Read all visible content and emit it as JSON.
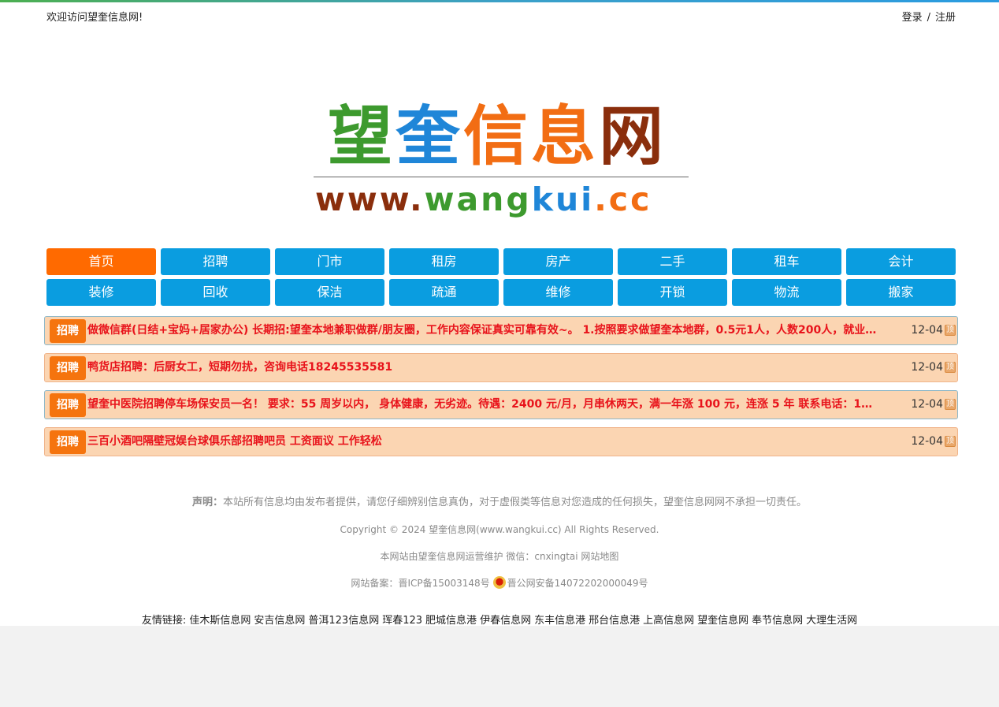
{
  "header": {
    "welcome": "欢迎访问望奎信息网!",
    "login": "登录",
    "separator": "/",
    "register": "注册"
  },
  "logo": {
    "cn_chars": [
      {
        "text": "望",
        "color": "#3d9a2e"
      },
      {
        "text": "奎",
        "color": "#1f86d8"
      },
      {
        "text": "信",
        "color": "#f26d13"
      },
      {
        "text": "息",
        "color": "#f26d13"
      },
      {
        "text": "网",
        "color": "#8a2e0c"
      }
    ],
    "url_parts": [
      {
        "text": "www.",
        "color": "#8a2e0c"
      },
      {
        "text": "wang",
        "color": "#3d9a2e"
      },
      {
        "text": "kui",
        "color": "#1f86d8"
      },
      {
        "text": ".cc",
        "color": "#f26d13"
      }
    ]
  },
  "nav": {
    "items": [
      "首页",
      "招聘",
      "门市",
      "租房",
      "房产",
      "二手",
      "租车",
      "会计",
      "装修",
      "回收",
      "保洁",
      "疏通",
      "维修",
      "开锁",
      "物流",
      "搬家"
    ],
    "active_index": 0
  },
  "listings": [
    {
      "tag": "招聘",
      "title": "做微信群(日结+宝妈+居家办公) 长期招:望奎本地兼职做群/朋友圈，工作内容保证真实可靠有效~。 1.按照要求做望奎本地群，0.5元1人，人数200人，就业…",
      "date": "12-04",
      "badge": "顶"
    },
    {
      "tag": "招聘",
      "title": "鸭货店招聘：后厨女工，短期勿扰，咨询电话18245535581",
      "date": "12-04",
      "badge": "顶"
    },
    {
      "tag": "招聘",
      "title": "望奎中医院招聘停车场保安员一名！ 要求：55 周岁以内， 身体健康，无劣迹。待遇：2400 元/月，月串休两天，满一年涨 100 元，连涨 5 年 联系电话：1…",
      "date": "12-04",
      "badge": "顶"
    },
    {
      "tag": "招聘",
      "title": "三百小酒吧隔壁冠娱台球俱乐部招聘吧员 工资面议 工作轻松",
      "date": "12-04",
      "badge": "顶"
    }
  ],
  "footer": {
    "declaration_label": "声明：",
    "declaration": "本站所有信息均由发布者提供，请您仔细辨别信息真伪，对于虚假类等信息对您造成的任何损失，望奎信息网网不承担一切责任。",
    "copyright": "Copyright © 2024 望奎信息网(www.wangkui.cc) All Rights Reserved.",
    "maintain": "本网站由望奎信息网运营维护 微信：cnxingtai 网站地图",
    "beian_label": "网站备案：",
    "icp": "晋ICP备15003148号",
    "police": "晋公网安备14072202000049号"
  },
  "friend_links": {
    "label": "友情链接:",
    "items": [
      "佳木斯信息网",
      "安吉信息网",
      "普洱123信息网",
      "珲春123",
      "肥城信息港",
      "伊春信息网",
      "东丰信息港",
      "邢台信息港",
      "上高信息网",
      "望奎信息网",
      "奉节信息网",
      "大理生活网"
    ]
  }
}
